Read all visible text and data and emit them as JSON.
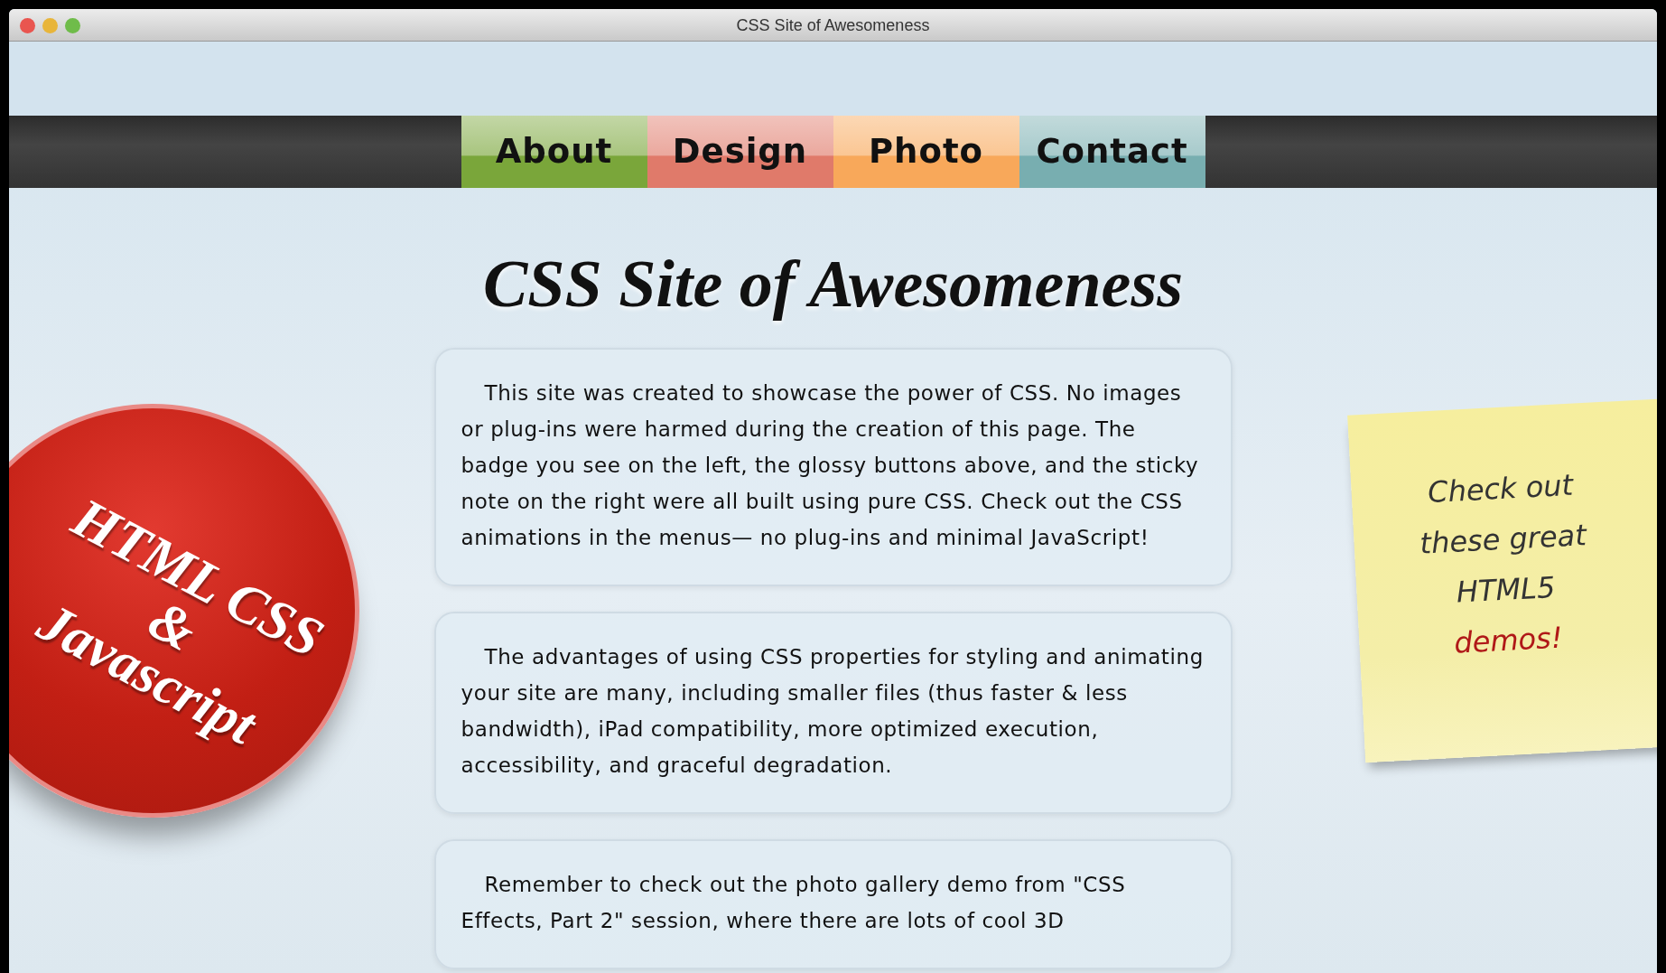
{
  "window": {
    "title": "CSS Site of Awesomeness"
  },
  "nav": [
    {
      "label": "About",
      "color": "#7aa63a"
    },
    {
      "label": "Design",
      "color": "#e07a6a"
    },
    {
      "label": "Photo",
      "color": "#f8a85a"
    },
    {
      "label": "Contact",
      "color": "#78aeb0"
    }
  ],
  "heading": "CSS Site of Awesomeness",
  "paragraphs": [
    "This site was created to showcase the power of CSS. No images or plug-ins were harmed during the creation of this page. The badge you see on the left, the glossy buttons above, and the sticky note on the right were all built using pure CSS. Check out the CSS animations in the menus— no plug-ins and minimal JavaScript!",
    "The advantages of using CSS properties for styling and animating your site are many, including smaller files (thus faster & less bandwidth), iPad compatibility, more optimized execution, accessibility, and graceful degradation.",
    "Remember to check out the photo gallery demo from \"CSS Effects, Part 2\" session, where there are lots of cool 3D"
  ],
  "badge": {
    "lines": [
      "HTML CSS",
      "&",
      "Javascript"
    ]
  },
  "sticky_note": {
    "lines": [
      {
        "text": "Check out",
        "kind": "plain"
      },
      {
        "text": "these great",
        "kind": "plain"
      },
      {
        "text": "HTML5",
        "kind": "plain"
      },
      {
        "text": "demos!",
        "kind": "accent"
      }
    ]
  }
}
